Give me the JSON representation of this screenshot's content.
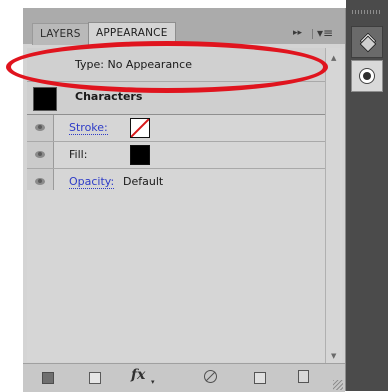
{
  "tabs": [
    {
      "label": "LAYERS"
    },
    {
      "label": "APPEARANCE"
    }
  ],
  "panel_controls": {
    "collapse_glyph": "▸▸",
    "menu_glyph": "▾≡"
  },
  "appearance": {
    "type_label": "Type: No Appearance",
    "target_label": "Characters",
    "target_swatch_color": "#000000",
    "attributes": [
      {
        "label": "Stroke:",
        "kind": "link",
        "swatch": "none"
      },
      {
        "label": "Fill:",
        "kind": "text",
        "swatch": "#000000"
      },
      {
        "label": "Opacity:",
        "kind": "link",
        "value": "Default"
      }
    ]
  },
  "toolbar": {
    "fx_label": "fx",
    "fx_caret": "▾",
    "buttons": [
      "new-art-basic-appearance-icon",
      "add-new-stroke-icon",
      "fx-icon",
      "clear-appearance-icon",
      "duplicate-item-icon",
      "delete-item-icon"
    ]
  },
  "scrollbar": {
    "up": "▲",
    "down": "▼"
  },
  "dock": {
    "icons": [
      "layers-stack-icon",
      "appearance-circle-icon"
    ]
  },
  "annotation": {
    "color": "#e0141e",
    "shape": "ellipse",
    "highlights": "type-row"
  }
}
